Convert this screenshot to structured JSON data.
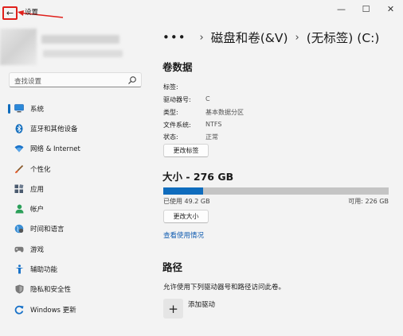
{
  "window": {
    "title": "设置",
    "back_icon": "←",
    "controls": [
      "—",
      "☐",
      "✕"
    ]
  },
  "search": {
    "placeholder": "查找设置"
  },
  "sidebar": {
    "items": [
      {
        "label": "系统",
        "icon": "system-icon",
        "active": true
      },
      {
        "label": "蓝牙和其他设备",
        "icon": "bluetooth-icon"
      },
      {
        "label": "网络 & Internet",
        "icon": "wifi-icon"
      },
      {
        "label": "个性化",
        "icon": "brush-icon"
      },
      {
        "label": "应用",
        "icon": "apps-icon"
      },
      {
        "label": "帐户",
        "icon": "account-icon"
      },
      {
        "label": "时间和语言",
        "icon": "globe-icon"
      },
      {
        "label": "游戏",
        "icon": "gamepad-icon"
      },
      {
        "label": "辅助功能",
        "icon": "accessibility-icon"
      },
      {
        "label": "隐私和安全性",
        "icon": "shield-icon"
      },
      {
        "label": "Windows 更新",
        "icon": "update-icon"
      }
    ]
  },
  "breadcrumb": {
    "dots": "•••",
    "separator": "›",
    "items": [
      "磁盘和卷(&V)",
      "(无标签) (C:)"
    ]
  },
  "volume": {
    "title": "卷数据",
    "props": [
      {
        "label": "标签:",
        "value": ""
      },
      {
        "label": "驱动器号:",
        "value": "C"
      },
      {
        "label": "类型:",
        "value": "基本数据分区"
      },
      {
        "label": "文件系统:",
        "value": "NTFS"
      },
      {
        "label": "状态:",
        "value": "正常"
      }
    ],
    "change_label_button": "更改标签"
  },
  "size": {
    "title": "大小 - 276 GB",
    "used_text": "已使用 49.2 GB",
    "free_text": "可用: 226 GB",
    "used_fraction": 0.178,
    "change_size_button": "更改大小",
    "usage_link": "查看使用情况"
  },
  "path": {
    "title": "路径",
    "description": "允许使用下列驱动器号和路径访问此卷。",
    "add_icon": "+",
    "add_label": "添加驱动"
  },
  "colors": {
    "accent": "#0f6cbd",
    "annotation": "#e0201b",
    "background": "#f3f3f3"
  }
}
